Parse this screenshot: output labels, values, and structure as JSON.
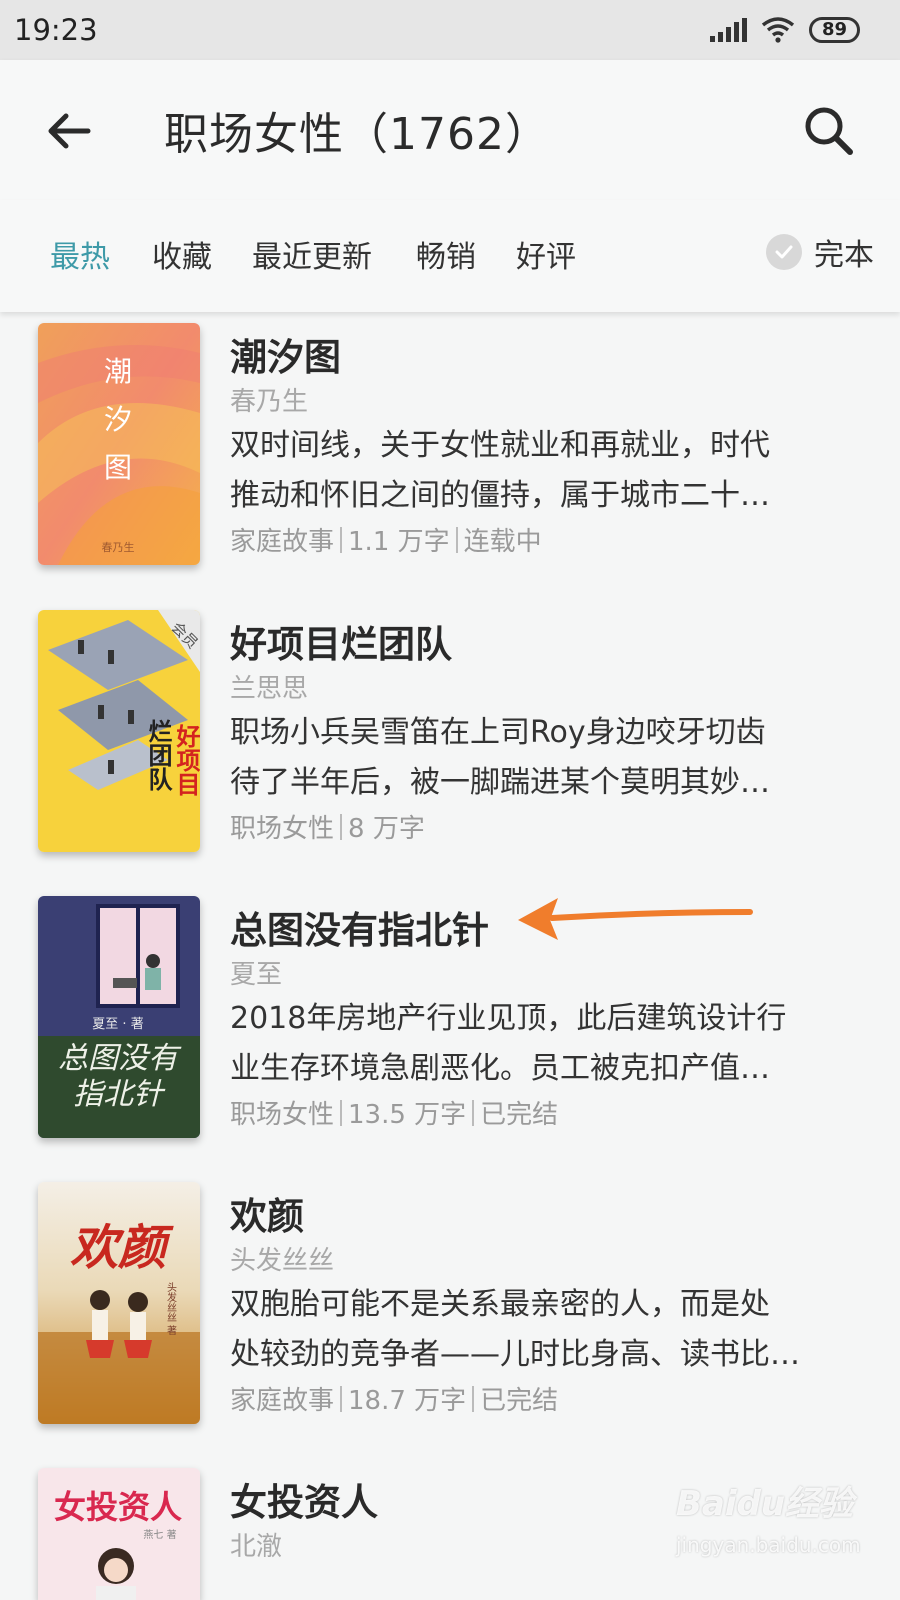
{
  "status_bar": {
    "time": "19:23",
    "battery": "89"
  },
  "header": {
    "title": "职场女性（1762）"
  },
  "filters": {
    "tabs": [
      "最热",
      "收藏",
      "最近更新",
      "畅销",
      "好评"
    ],
    "active_index": 0,
    "complete_label": "完本"
  },
  "books": [
    {
      "title": "潮汐图",
      "author": "春乃生",
      "desc_line1": "双时间线，关于女性就业和再就业，时代",
      "desc_line2": "推动和怀旧之间的僵持，属于城市二十…",
      "meta": [
        "家庭故事",
        "1.1 万字",
        "连载中"
      ],
      "cover_text": "潮汐图",
      "cover_small": "春乃生"
    },
    {
      "title": "好项目烂团队",
      "author": "兰思思",
      "desc_line1": "职场小兵吴雪笛在上司Roy身边咬牙切齿",
      "desc_line2": "待了半年后，被一脚踹进某个莫明其妙…",
      "meta": [
        "职场女性",
        "8 万字"
      ],
      "cover_badge": "会员",
      "cover_text_a": "好项目",
      "cover_text_b": "烂团队"
    },
    {
      "title": "总图没有指北针",
      "author": "夏至",
      "desc_line1": "2018年房地产行业见顶，此后建筑设计行",
      "desc_line2": "业生存环境急剧恶化。员工被克扣产值…",
      "meta": [
        "职场女性",
        "13.5 万字",
        "已完结"
      ],
      "cover_author": "夏至 · 著",
      "cover_text_a": "总图没有",
      "cover_text_b": "指北针"
    },
    {
      "title": "欢颜",
      "author": "头发丝丝",
      "desc_line1": "双胞胎可能不是关系最亲密的人，而是处",
      "desc_line2": "处较劲的竞争者——儿时比身高、读书比…",
      "meta": [
        "家庭故事",
        "18.7 万字",
        "已完结"
      ],
      "cover_text": "欢颜",
      "cover_author": "头发丝丝 著"
    },
    {
      "title": "女投资人",
      "author": "北澈",
      "cover_text": "女投资人",
      "cover_author": "燕七 著"
    }
  ],
  "colors": {
    "accent": "#3e9aa8",
    "arrow": "#f07d2c"
  },
  "watermark": {
    "line1": "Baidu经验",
    "line2": "jingyan.baidu.com"
  }
}
